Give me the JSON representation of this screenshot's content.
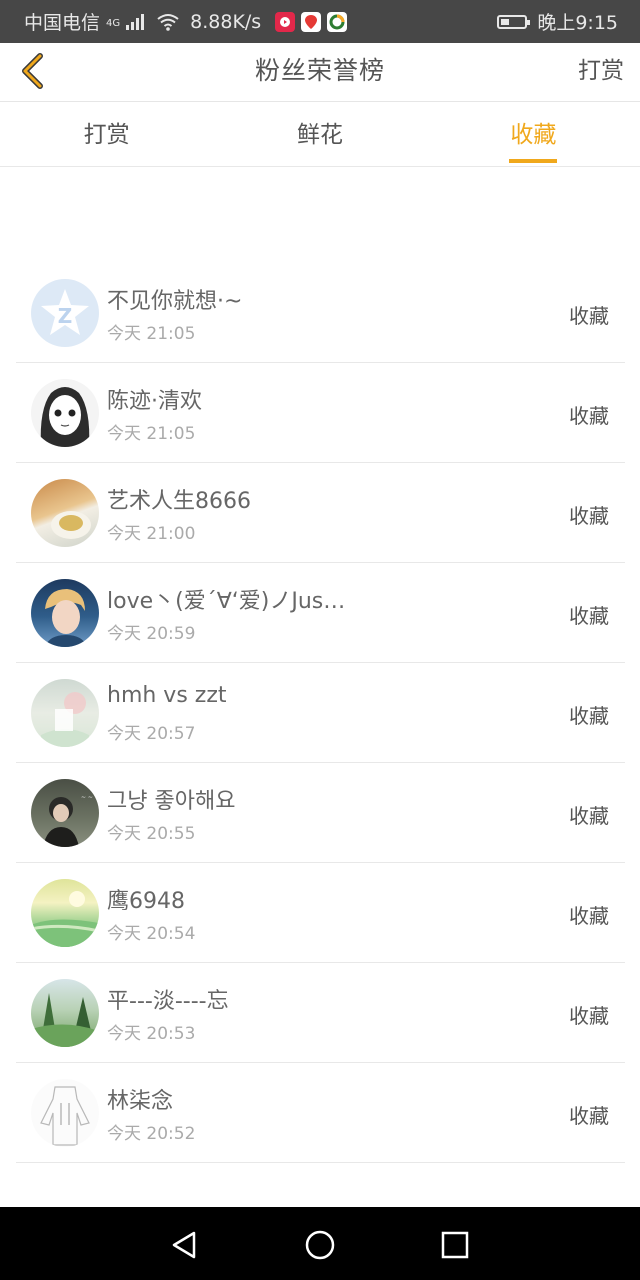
{
  "status_bar": {
    "carrier": "中国电信",
    "network": "4G",
    "speed": "8.88K/s",
    "time": "晚上9:15",
    "battery_level": 0.3
  },
  "header": {
    "title": "粉丝荣誉榜",
    "action_label": "打赏"
  },
  "tabs": [
    {
      "label": "打赏",
      "active": false
    },
    {
      "label": "鲜花",
      "active": false
    },
    {
      "label": "收藏",
      "active": true
    }
  ],
  "accent_color": "#f0a81c",
  "items": [
    {
      "name": "不见你就想·~",
      "time": "今天 21:05",
      "type": "收藏"
    },
    {
      "name": "陈迹·清欢",
      "time": "今天 21:05",
      "type": "收藏"
    },
    {
      "name": "艺术人生8666",
      "time": "今天 21:00",
      "type": "收藏"
    },
    {
      "name": "love丶(爱´∀‘爱)ノJus…",
      "time": "今天 20:59",
      "type": "收藏"
    },
    {
      "name": "hmh vs zzt",
      "time": "今天 20:57",
      "type": "收藏"
    },
    {
      "name": "그냥 좋아해요",
      "time": "今天 20:55",
      "type": "收藏"
    },
    {
      "name": "鹰6948",
      "time": "今天 20:54",
      "type": "收藏"
    },
    {
      "name": "平---淡----忘",
      "time": "今天 20:53",
      "type": "收藏"
    },
    {
      "name": "林柒念",
      "time": "今天 20:52",
      "type": "收藏"
    }
  ]
}
